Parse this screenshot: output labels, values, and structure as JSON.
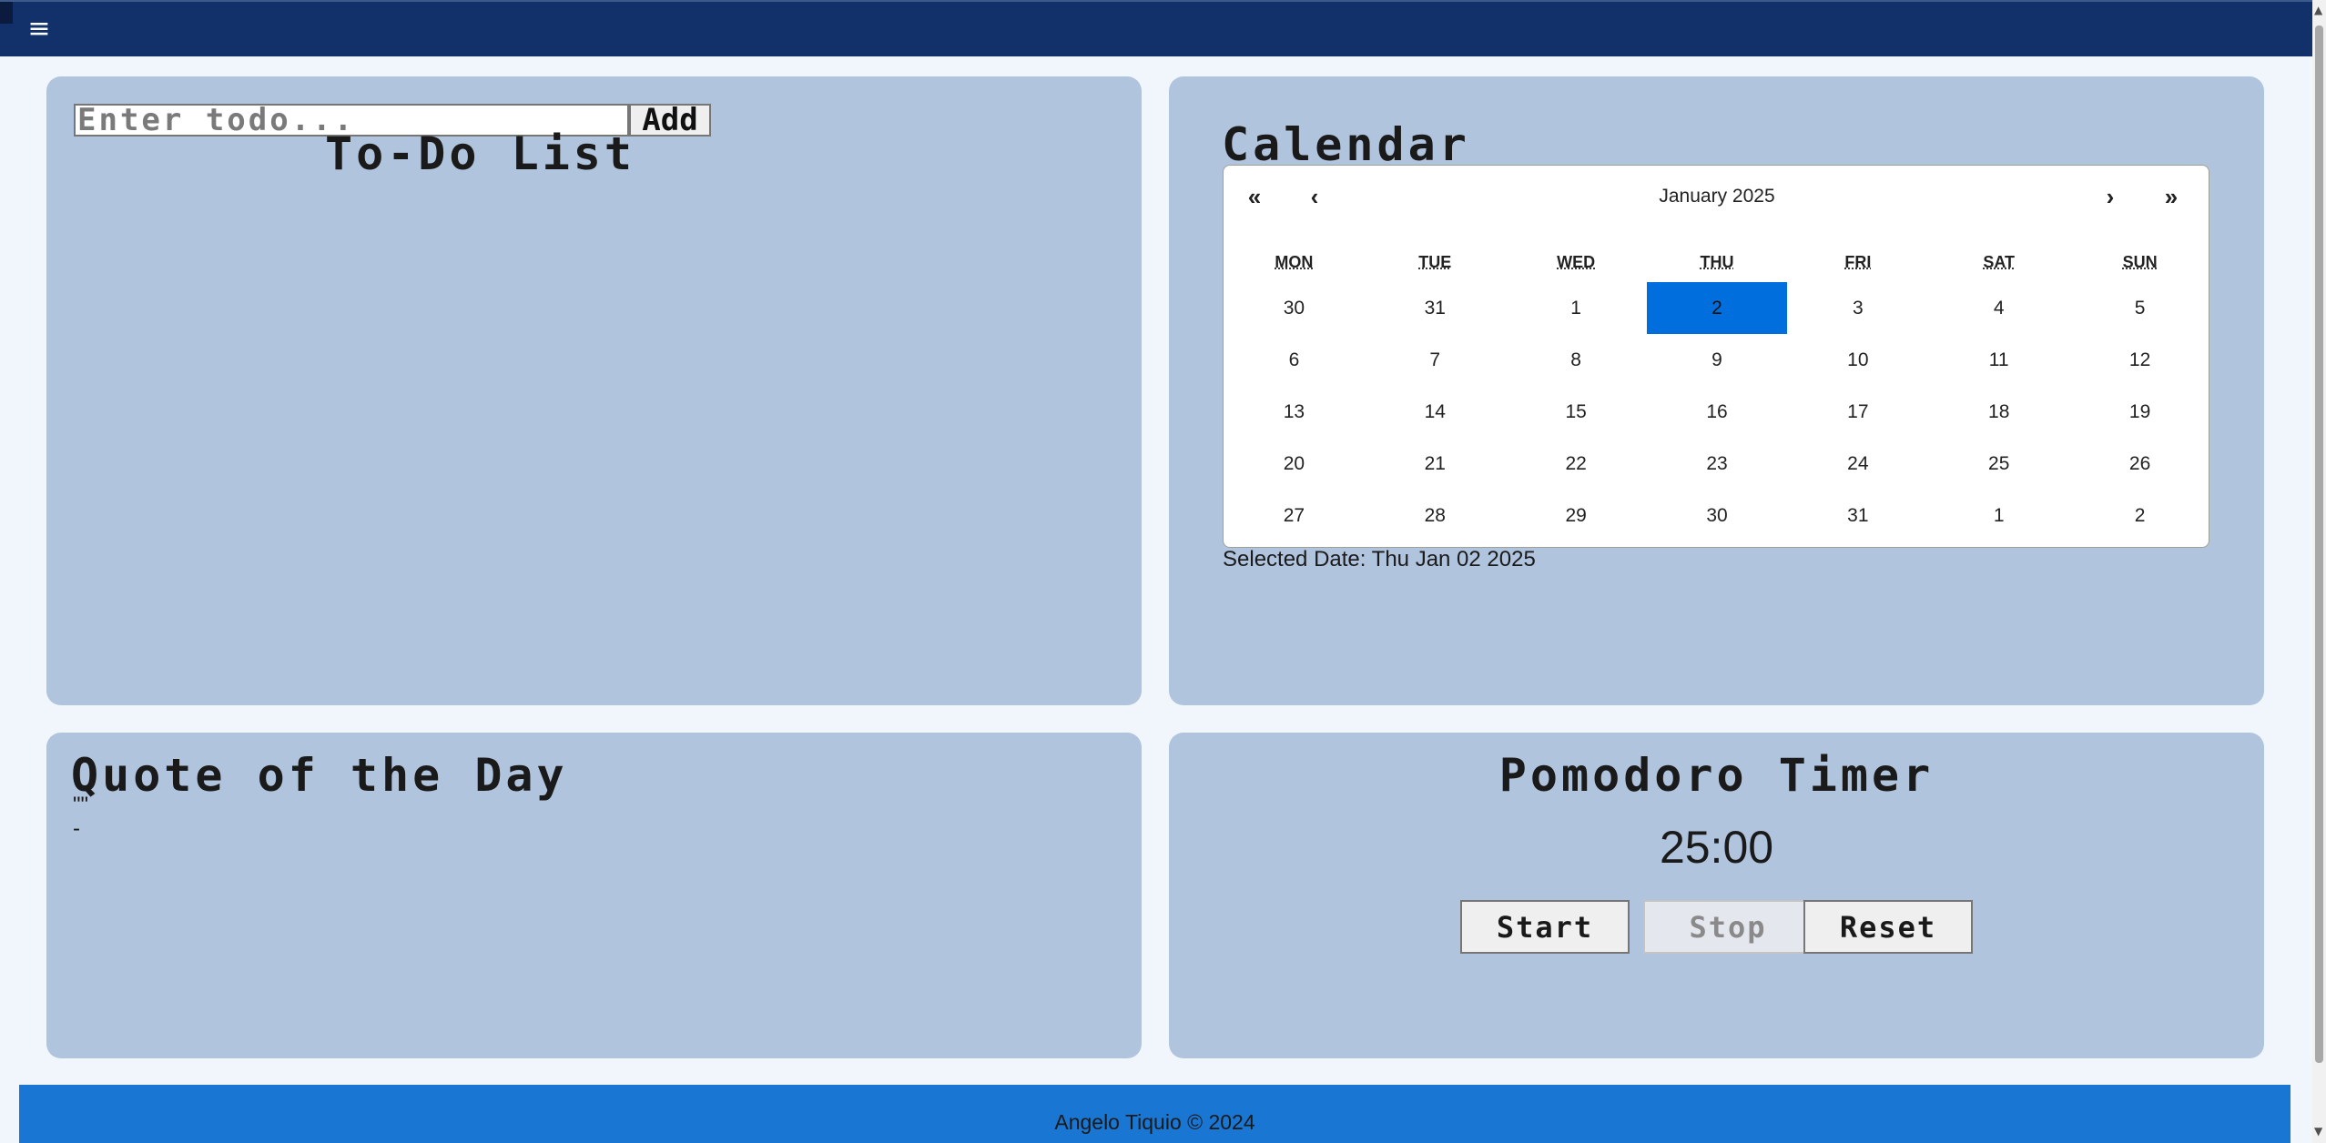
{
  "header": {
    "menu_icon": "≡"
  },
  "todo": {
    "input_placeholder": "Enter todo...",
    "add_label": "Add",
    "title": "To-Do List"
  },
  "calendar": {
    "title": "Calendar",
    "nav": {
      "prev2": "«",
      "prev": "‹",
      "next": "›",
      "next2": "»"
    },
    "month_label": "January 2025",
    "weekdays": [
      "MON",
      "TUE",
      "WED",
      "THU",
      "FRI",
      "SAT",
      "SUN"
    ],
    "days": [
      "30",
      "31",
      "1",
      "2",
      "3",
      "4",
      "5",
      "6",
      "7",
      "8",
      "9",
      "10",
      "11",
      "12",
      "13",
      "14",
      "15",
      "16",
      "17",
      "18",
      "19",
      "20",
      "21",
      "22",
      "23",
      "24",
      "25",
      "26",
      "27",
      "28",
      "29",
      "30",
      "31",
      "1",
      "2"
    ],
    "selected_index": 3,
    "selected_text": "Selected Date: Thu Jan 02 2025",
    "selected_color": "#006edc"
  },
  "quote": {
    "title": "Quote of the Day",
    "text": "\"\"",
    "author": "-"
  },
  "pomodoro": {
    "title": "Pomodoro Timer",
    "time": "25:00",
    "start_label": "Start",
    "stop_label": "Stop",
    "reset_label": "Reset"
  },
  "footer": {
    "text": "Angelo Tiquio © 2024"
  },
  "colors": {
    "header_bg": "#12306a",
    "card_bg": "#b0c4de",
    "page_bg": "#f0f6fc",
    "footer_bg": "#1976d2"
  }
}
